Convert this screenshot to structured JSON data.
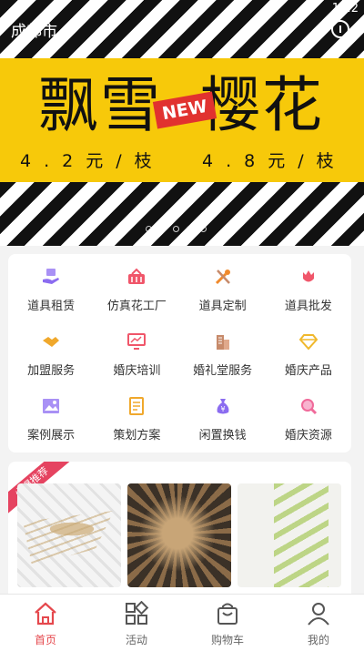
{
  "status_bar": {
    "time": "12:2"
  },
  "header": {
    "city": "成都市"
  },
  "banner": {
    "title_left": "飘雪",
    "title_right": "樱花",
    "badge": "NEW",
    "price_1": "4.2元/枝",
    "price_2": "4.8元/枝"
  },
  "categories": [
    {
      "label": "道具租赁",
      "icon": "hand-box-icon",
      "color": "#8b6cf0"
    },
    {
      "label": "仿真花工厂",
      "icon": "basket-icon",
      "color": "#f0566a"
    },
    {
      "label": "道具定制",
      "icon": "tools-icon",
      "color": "#f08a2c"
    },
    {
      "label": "道具批发",
      "icon": "tulip-icon",
      "color": "#f0566a"
    },
    {
      "label": "加盟服务",
      "icon": "handshake-icon",
      "color": "#f0a82c"
    },
    {
      "label": "婚庆培训",
      "icon": "monitor-icon",
      "color": "#f0566a"
    },
    {
      "label": "婚礼堂服务",
      "icon": "building-icon",
      "color": "#c78a6a"
    },
    {
      "label": "婚庆产品",
      "icon": "diamond-icon",
      "color": "#f0b82c"
    },
    {
      "label": "案例展示",
      "icon": "picture-icon",
      "color": "#8b6cf0"
    },
    {
      "label": "策划方案",
      "icon": "document-icon",
      "color": "#f0a82c"
    },
    {
      "label": "闲置换钱",
      "icon": "money-bag-icon",
      "color": "#8b6cf0"
    },
    {
      "label": "婚庆资源",
      "icon": "magnifier-icon",
      "color": "#f06a9a"
    }
  ],
  "recommend": {
    "ribbon": "火爆推荐"
  },
  "tabs": [
    {
      "label": "首页",
      "icon": "home-icon",
      "active": true
    },
    {
      "label": "活动",
      "icon": "grid-icon",
      "active": false
    },
    {
      "label": "购物车",
      "icon": "bag-icon",
      "active": false
    },
    {
      "label": "我的",
      "icon": "user-icon",
      "active": false
    }
  ],
  "colors": {
    "accent": "#e5484d",
    "banner_yellow": "#f7c90a"
  }
}
